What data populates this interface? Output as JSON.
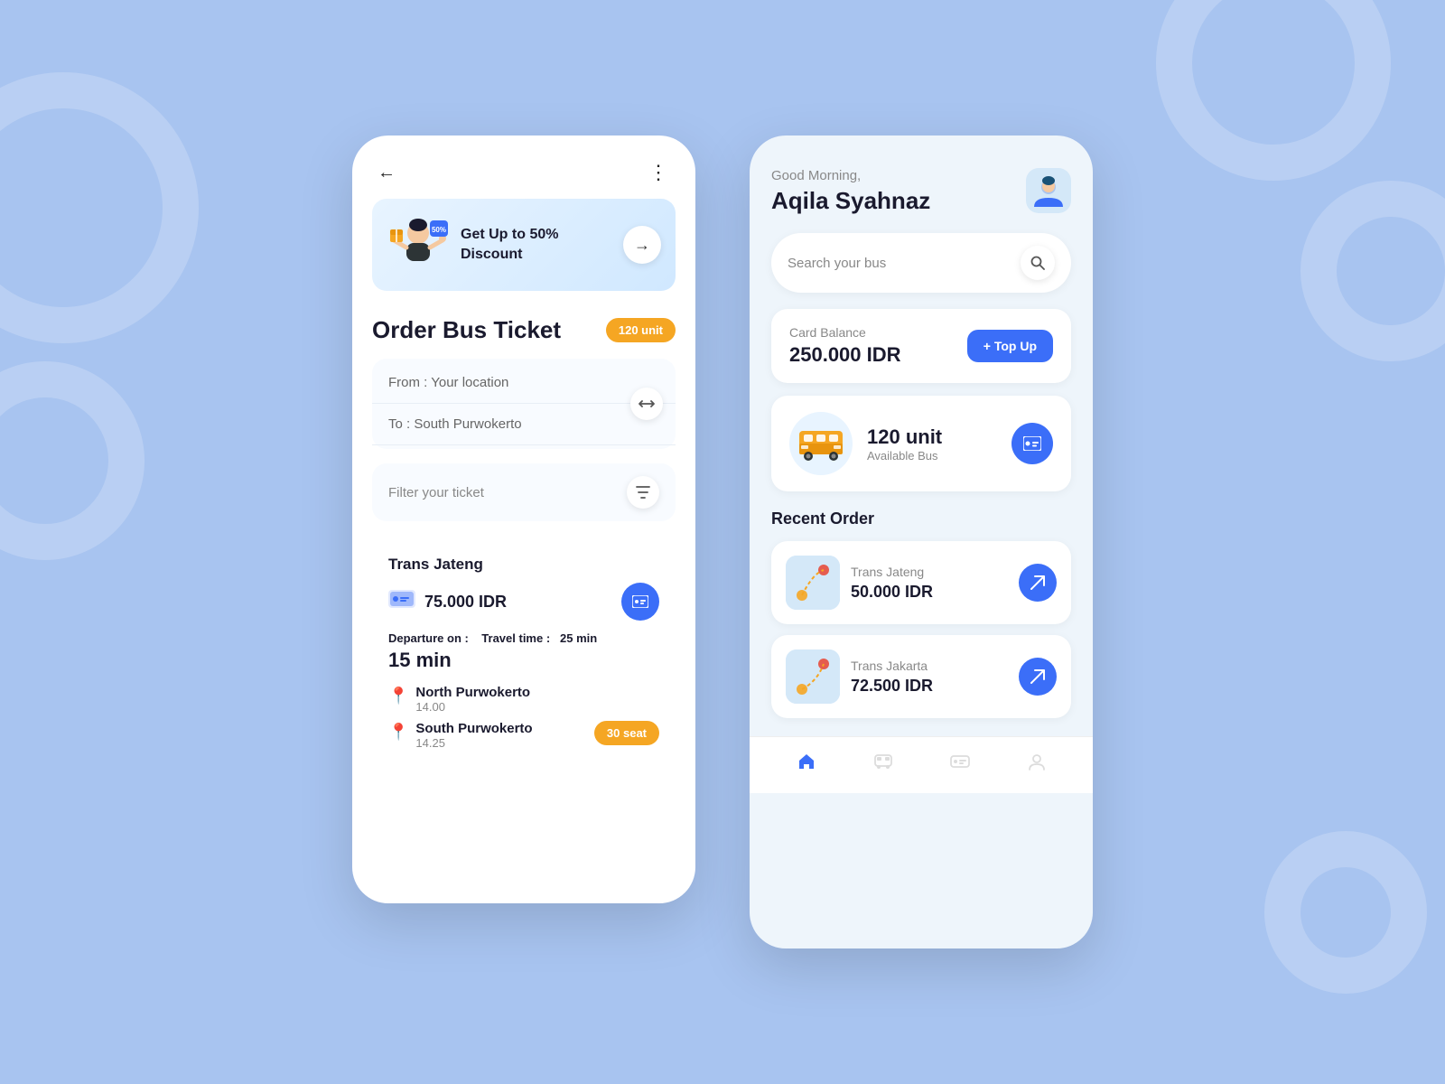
{
  "background": {
    "color": "#a8c4f0"
  },
  "phone1": {
    "back_button": "←",
    "more_button": "⋮",
    "promo": {
      "text": "Get Up to\n50% Discount",
      "badge": "50%",
      "arrow": "→"
    },
    "order_title": "Order Bus Ticket",
    "unit_badge": "120 unit",
    "from_label": "From : Your location",
    "to_label": "To : South Purwokerto",
    "filter_label": "Filter your ticket",
    "bus_result": {
      "company": "Trans Jateng",
      "price": "75.000 IDR",
      "departure_label": "Departure on :",
      "travel_time_label": "Travel time :",
      "travel_time_value": "25 min",
      "duration": "15 min",
      "stop1_name": "North Purwokerto",
      "stop1_time": "14.00",
      "stop2_name": "South Purwokerto",
      "stop2_time": "14.25",
      "seat_badge": "30 seat"
    }
  },
  "phone2": {
    "greeting": "Good Morning,",
    "user_name": "Aqila Syahnaz",
    "search_placeholder": "Search your bus",
    "card_balance": {
      "label": "Card Balance",
      "amount": "250.000 IDR",
      "topup_btn": "+ Top Up"
    },
    "available_bus": {
      "count": "120 unit",
      "label": "Available Bus"
    },
    "recent_order_title": "Recent Order",
    "orders": [
      {
        "company": "Trans Jateng",
        "price": "50.000 IDR"
      },
      {
        "company": "Trans Jakarta",
        "price": "72.500 IDR"
      }
    ],
    "nav": {
      "home": "Home",
      "bus": "Bus",
      "ticket": "Ticket",
      "profile": "Profile"
    }
  }
}
